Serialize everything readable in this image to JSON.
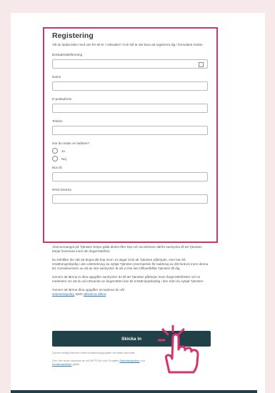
{
  "form": {
    "title": "Registering",
    "intro": "Vill du ladda bilen med oss för 69 kr i månaden? Kul! Då är det bara att registrera dig i formuläret nedan.",
    "fields": [
      {
        "label": "Bostadsrättsförening",
        "type": "select"
      },
      {
        "label": "Namn",
        "type": "text"
      },
      {
        "label": "E-postadress",
        "type": "text"
      },
      {
        "label": "Telefon",
        "type": "text"
      }
    ],
    "question": "Har du redan en laddare?",
    "options": [
      "Ja",
      "Nej"
    ],
    "box_id_label": "Box ID",
    "rfid_label": "RFID brickmr"
  },
  "info": {
    "p1": "Abonnemanget på Tjänsten börjar gälla direkt efter köp och du behöver därför samtycka till att Tjänsten börjar levereras inom din ångerrättsfrist.",
    "p2": "Du behåller din rätt att ångra ditt köp inom 14 dagar trots att Tjänsten påbörjats, men kan bli ersättningsskyldig i den utsträckning du nyttjat Tjänsten (exempelvis för laddning av ditt fordon) inom denna tid. Konsekvensen av att du inte samtycker är att vi inte kan tillhandhålla Tjänsten till dig.",
    "p3": "Genom att lämna in dina uppgifter samtycker du till att Tjänsten påbörjas inom ångerrättsfristen och är medveten om att du vid utövande av ångerrätten kan bli ersättningsskyldig i den mån du nyttjat Tjänsten.",
    "p4_prefix": "Genom att lämna dina uppgifter accepterar du vår",
    "privacy_link": "sekretesspolicy",
    "p4_mid": "samt",
    "terms_link": "allmänna villkor",
    "p4_suffix": "."
  },
  "submit_label": "Skicka in",
  "footer": {
    "line1": "Lämna aldrig lösenord eller kreditkortsuppgifter via detta formulär.",
    "line2_prefix": "Den här sidan skyddas av reCAPTCHA och Googles",
    "privacy_link": "Sekretesspolicy",
    "line2_mid": "och",
    "terms_link": "Användarvillkor",
    "line2_suffix": "gäller."
  },
  "colors": {
    "accent": "#d6336c",
    "button": "#1f4147",
    "background": "#f7e9ea"
  },
  "icons": [
    "hand-pointer-icon",
    "select-grid-icon"
  ]
}
